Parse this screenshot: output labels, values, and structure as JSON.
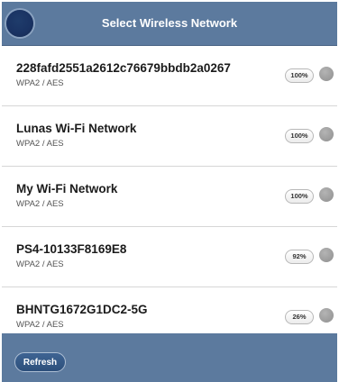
{
  "header": {
    "title": "Select Wireless Network"
  },
  "networks": [
    {
      "ssid": "228fafd2551a2612c76679bbdb2a0267",
      "security": "WPA2 / AES",
      "signal": "100%"
    },
    {
      "ssid": "Lunas Wi-Fi Network",
      "security": "WPA2 / AES",
      "signal": "100%"
    },
    {
      "ssid": "My Wi-Fi Network",
      "security": "WPA2 / AES",
      "signal": "100%"
    },
    {
      "ssid": "PS4-10133F8169E8",
      "security": "WPA2 / AES",
      "signal": "92%"
    },
    {
      "ssid": "BHNTG1672G1DC2-5G",
      "security": "WPA2 / AES",
      "signal": "26%"
    }
  ],
  "footer": {
    "refresh_label": "Refresh"
  },
  "colors": {
    "header_bg": "#5c7a9e",
    "button_bg": "#2d4f7b"
  }
}
